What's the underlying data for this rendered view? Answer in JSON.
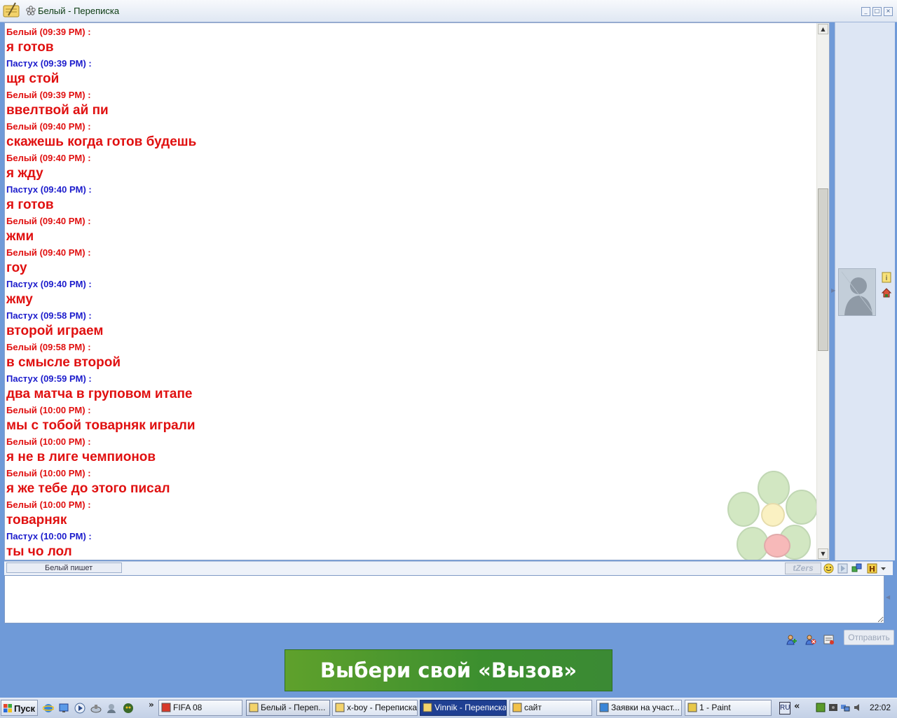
{
  "window": {
    "title": "Белый - Переписка",
    "buttons": [
      "_",
      "□",
      "×"
    ]
  },
  "contacts": {
    "me": {
      "name": "Белый",
      "color": "#e01010"
    },
    "peer": {
      "name": "Пастух",
      "color": "#1c1ccc"
    }
  },
  "messages": [
    {
      "sender": "Белый",
      "time": "(09:39 PM) :",
      "text": "я готов"
    },
    {
      "sender": "Пастух",
      "time": "(09:39 PM) :",
      "text": "щя стой"
    },
    {
      "sender": "Белый",
      "time": "(09:39 PM) :",
      "text": "ввелтвой ай пи"
    },
    {
      "sender": "Белый",
      "time": "(09:40 PM) :",
      "text": "скажешь когда готов будешь"
    },
    {
      "sender": "Белый",
      "time": "(09:40 PM) :",
      "text": "я жду"
    },
    {
      "sender": "Пастух",
      "time": "(09:40 PM) :",
      "text": "я готов"
    },
    {
      "sender": "Белый",
      "time": "(09:40 PM) :",
      "text": "жми"
    },
    {
      "sender": "Белый",
      "time": "(09:40 PM) :",
      "text": "гоу"
    },
    {
      "sender": "Пастух",
      "time": "(09:40 PM) :",
      "text": "жму"
    },
    {
      "sender": "Пастух",
      "time": "(09:58 PM) :",
      "text": "второй играем"
    },
    {
      "sender": "Белый",
      "time": "(09:58 PM) :",
      "text": "в смысле второй"
    },
    {
      "sender": "Пастух",
      "time": "(09:59 PM) :",
      "text": "два матча в груповом итапе"
    },
    {
      "sender": "Белый",
      "time": "(10:00 PM) :",
      "text": "мы с тобой товарняк играли"
    },
    {
      "sender": "Белый",
      "time": "(10:00 PM) :",
      "text": "я не в лиге чемпионов"
    },
    {
      "sender": "Белый",
      "time": "(10:00 PM) :",
      "text": "я же тебе до этого писал"
    },
    {
      "sender": "Белый",
      "time": "(10:00 PM) :",
      "text": "товарняк"
    },
    {
      "sender": "Пастух",
      "time": "(10:00 PM) :",
      "text": "ты чо лол"
    }
  ],
  "status_bar": {
    "typing": "Белый пишет",
    "tzers": "tZers",
    "tool_icons": [
      "smiley-icon",
      "play-icon",
      "puzzle-icon",
      "h-icon",
      "dropdown-arrow-icon"
    ]
  },
  "input": {
    "value": ""
  },
  "send_button": {
    "label": "Отправить"
  },
  "banner": {
    "text": "Выбери свой «Вызов»"
  },
  "taskbar": {
    "start_label": "Пуск",
    "quick_launch_more": "»",
    "tasks": [
      {
        "label": "FIFA 08",
        "icon": "fifa-icon",
        "state": "normal"
      },
      {
        "label": "Белый - Переп...",
        "icon": "icq-chat-icon",
        "state": "active"
      },
      {
        "label": "x-boy - Переписка",
        "icon": "icq-chat-icon",
        "state": "normal"
      },
      {
        "label": "Vinnik - Переписка",
        "icon": "icq-chat-icon",
        "state": "focused"
      },
      {
        "label": "сайт",
        "icon": "folder-icon",
        "state": "normal"
      },
      {
        "label": "Заявки на участ...",
        "icon": "ie-icon",
        "state": "normal"
      },
      {
        "label": "1 - Paint",
        "icon": "paint-icon",
        "state": "normal"
      }
    ],
    "language": "RU",
    "tray_arrow": "«",
    "clock": "22:02"
  },
  "colors": {
    "window_bg": "#6f9ad8",
    "banner_green": "#3c8f2f",
    "focused_task": "#1f3f92"
  }
}
